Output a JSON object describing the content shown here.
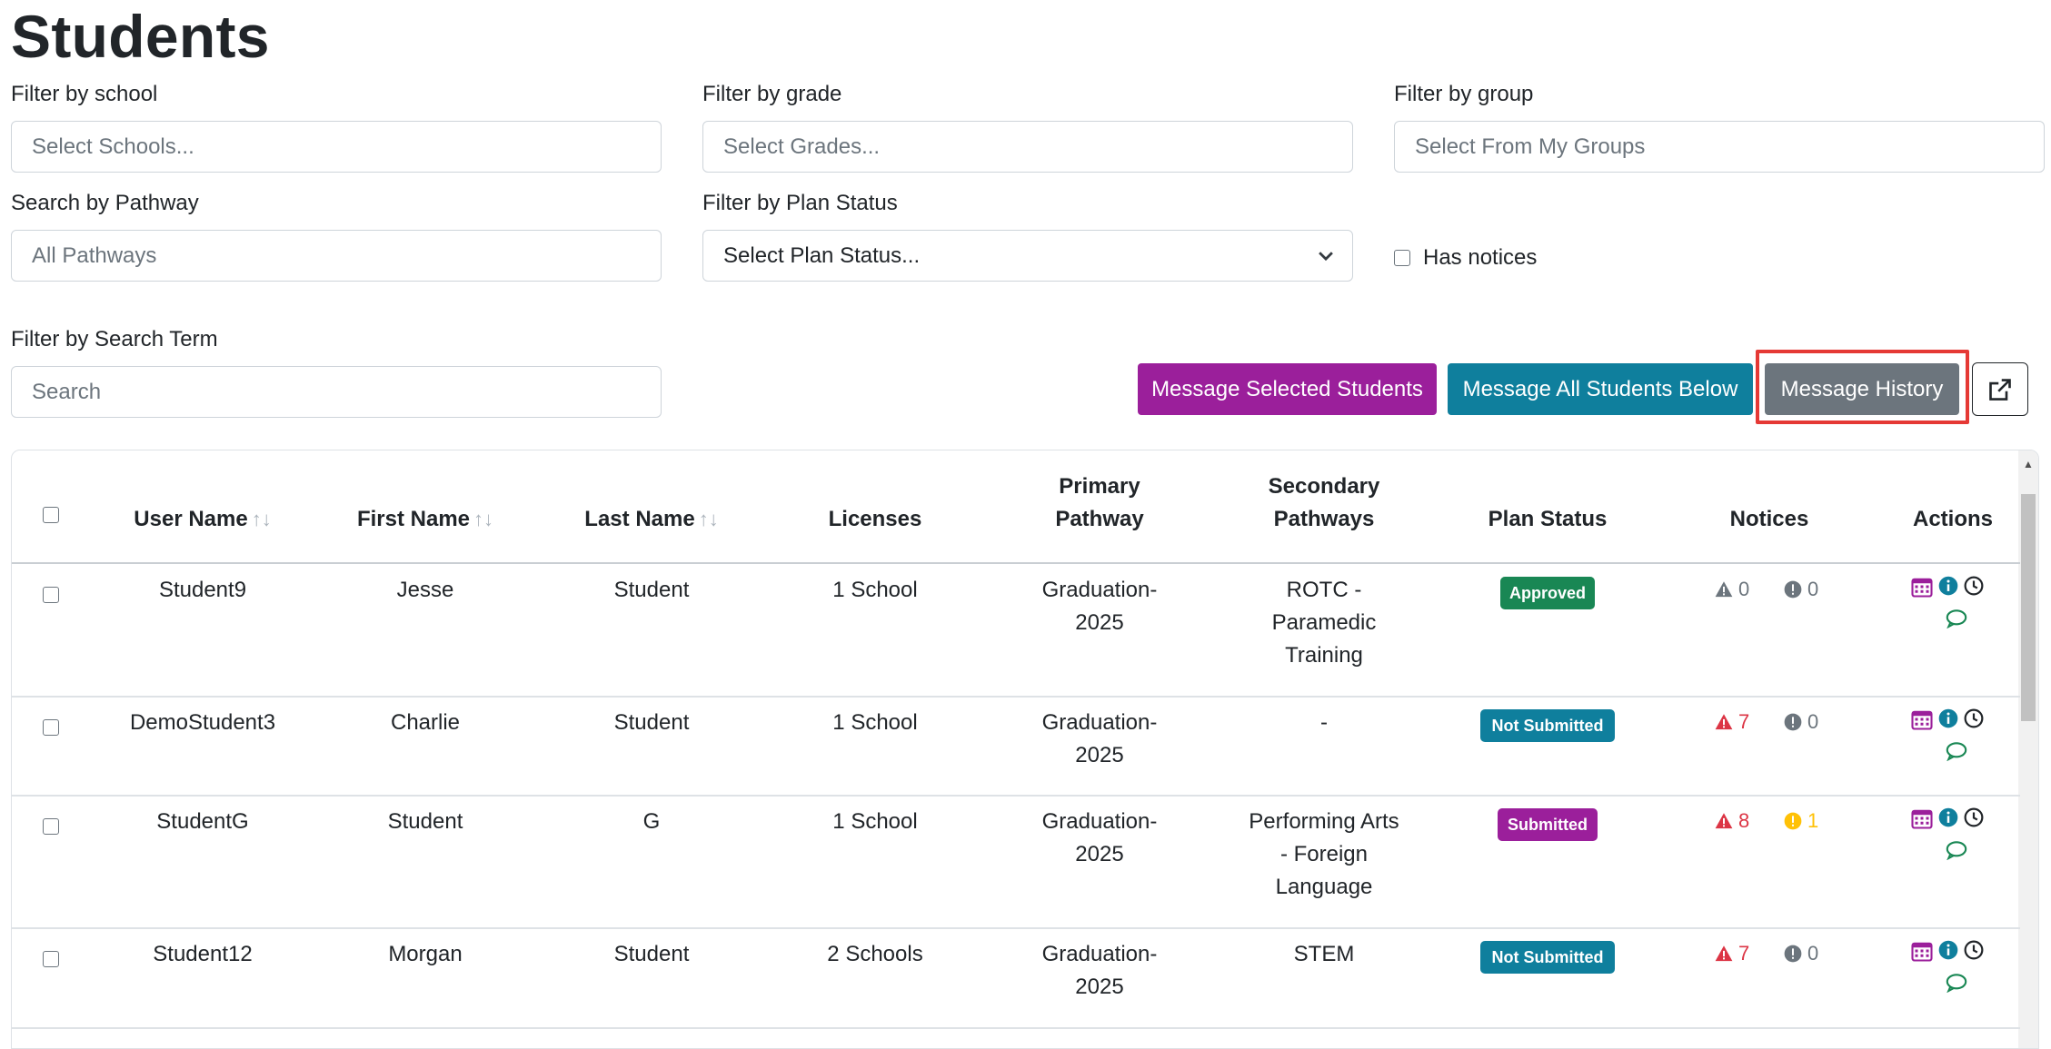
{
  "page_title": "Students",
  "filters": {
    "school": {
      "label": "Filter by school",
      "placeholder": "Select Schools..."
    },
    "grade": {
      "label": "Filter by grade",
      "placeholder": "Select Grades..."
    },
    "group": {
      "label": "Filter by group",
      "placeholder": "Select From My Groups"
    },
    "pathway": {
      "label": "Search by Pathway",
      "placeholder": "All Pathways"
    },
    "plan_status": {
      "label": "Filter by Plan Status",
      "placeholder": "Select Plan Status..."
    },
    "has_notices": {
      "label": "Has notices",
      "checked": false
    },
    "search": {
      "label": "Filter by Search Term",
      "placeholder": "Search"
    }
  },
  "buttons": {
    "message_selected": "Message Selected Students",
    "message_all": "Message All Students Below",
    "message_history": "Message History",
    "external_link_icon": "external-link-icon"
  },
  "colors": {
    "purple": "#9b1f9b",
    "teal": "#0f7f9d",
    "gray": "#6c757d",
    "green": "#198754",
    "danger": "#dc3545",
    "warning": "#ffc107",
    "highlight": "#e53935"
  },
  "table": {
    "headers": {
      "user_name": "User Name",
      "first_name": "First Name",
      "last_name": "Last Name",
      "licenses": "Licenses",
      "primary_pathway_1": "Primary",
      "primary_pathway_2": "Pathway",
      "secondary_pathways_1": "Secondary",
      "secondary_pathways_2": "Pathways",
      "plan_status": "Plan Status",
      "notices": "Notices",
      "actions": "Actions",
      "sort_icon": "↑↓"
    },
    "rows": [
      {
        "user_name": "Student9",
        "first_name": "Jesse",
        "last_name": "Student",
        "licenses": "1 School",
        "primary_1": "Graduation-",
        "primary_2": "2025",
        "secondary_1": "ROTC -",
        "secondary_2": "Paramedic",
        "secondary_3": "Training",
        "status": "Approved",
        "status_color": "green",
        "warnings": "0",
        "warnings_active": false,
        "alerts": "0",
        "alerts_active": false
      },
      {
        "user_name": "DemoStudent3",
        "first_name": "Charlie",
        "last_name": "Student",
        "licenses": "1 School",
        "primary_1": "Graduation-",
        "primary_2": "2025",
        "secondary_1": "-",
        "secondary_2": "",
        "secondary_3": "",
        "status": "Not Submitted",
        "status_color": "teal",
        "warnings": "7",
        "warnings_active": true,
        "alerts": "0",
        "alerts_active": false
      },
      {
        "user_name": "StudentG",
        "first_name": "Student",
        "last_name": "G",
        "licenses": "1 School",
        "primary_1": "Graduation-",
        "primary_2": "2025",
        "secondary_1": "Performing Arts",
        "secondary_2": "- Foreign",
        "secondary_3": "Language",
        "status": "Submitted",
        "status_color": "purple",
        "warnings": "8",
        "warnings_active": true,
        "alerts": "1",
        "alerts_active": true
      },
      {
        "user_name": "Student12",
        "first_name": "Morgan",
        "last_name": "Student",
        "licenses": "2 Schools",
        "primary_1": "Graduation-",
        "primary_2": "2025",
        "secondary_1": "STEM",
        "secondary_2": "",
        "secondary_3": "",
        "status": "Not Submitted",
        "status_color": "teal",
        "warnings": "7",
        "warnings_active": true,
        "alerts": "0",
        "alerts_active": false
      }
    ],
    "action_icons": [
      "calendar-icon",
      "info-icon",
      "clock-icon",
      "comment-icon"
    ]
  }
}
